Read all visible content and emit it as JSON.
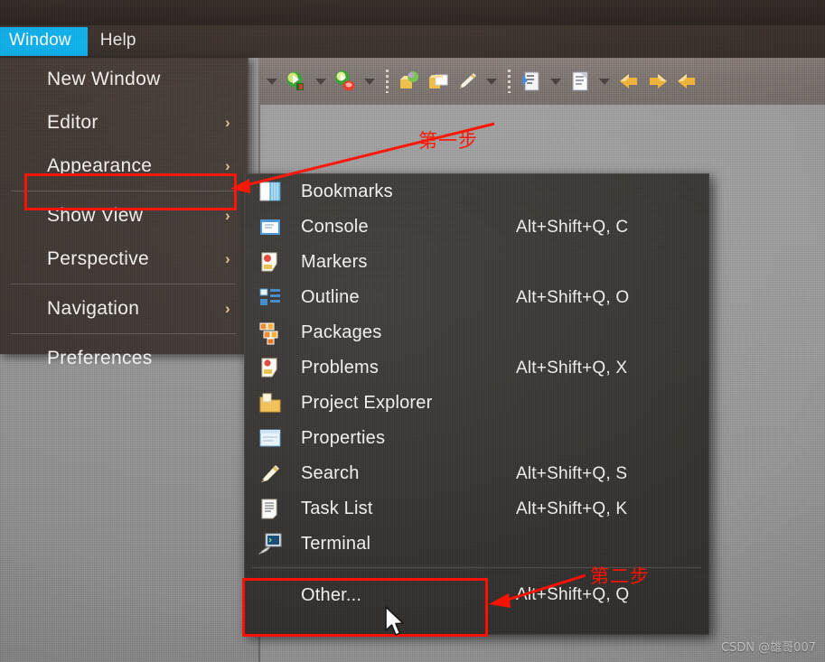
{
  "menubar": {
    "items": [
      {
        "label": "Window",
        "active": true
      },
      {
        "label": "Help",
        "active": false
      }
    ]
  },
  "window_menu": {
    "items": [
      {
        "label": "New Window",
        "arrow": ""
      },
      {
        "label": "Editor",
        "arrow": "›"
      },
      {
        "label": "Appearance",
        "arrow": "›"
      },
      {
        "label": "Show View",
        "arrow": "›"
      },
      {
        "label": "Perspective",
        "arrow": "›"
      },
      {
        "label": "Navigation",
        "arrow": "›"
      },
      {
        "label": "Preferences",
        "arrow": ""
      }
    ]
  },
  "show_view_submenu": {
    "items": [
      {
        "icon": "bookmarks-icon",
        "label": "Bookmarks",
        "shortcut": ""
      },
      {
        "icon": "console-icon",
        "label": "Console",
        "shortcut": "Alt+Shift+Q, C"
      },
      {
        "icon": "markers-icon",
        "label": "Markers",
        "shortcut": ""
      },
      {
        "icon": "outline-icon",
        "label": "Outline",
        "shortcut": "Alt+Shift+Q, O"
      },
      {
        "icon": "packages-icon",
        "label": "Packages",
        "shortcut": ""
      },
      {
        "icon": "problems-icon",
        "label": "Problems",
        "shortcut": "Alt+Shift+Q, X"
      },
      {
        "icon": "project-explorer-icon",
        "label": "Project Explorer",
        "shortcut": ""
      },
      {
        "icon": "properties-icon",
        "label": "Properties",
        "shortcut": ""
      },
      {
        "icon": "search-icon",
        "label": "Search",
        "shortcut": "Alt+Shift+Q, S"
      },
      {
        "icon": "task-list-icon",
        "label": "Task List",
        "shortcut": "Alt+Shift+Q, K"
      },
      {
        "icon": "terminal-icon",
        "label": "Terminal",
        "shortcut": ""
      }
    ],
    "other": {
      "label": "Other...",
      "shortcut": "Alt+Shift+Q, Q"
    }
  },
  "toolbar": {
    "icons": [
      "run-icon",
      "run-dropdown-caret",
      "debug-icon",
      "debug-dropdown-caret",
      "separator-1",
      "external-tools-icon",
      "open-type-icon",
      "new-icon",
      "new-dropdown-caret",
      "separator-2",
      "next-annotation-icon",
      "next-annotation-caret",
      "previous-edit-icon",
      "previous-edit-caret",
      "back-icon",
      "forward-icon",
      "back-arrow-icon"
    ]
  },
  "annotations": {
    "step_one": "第一步",
    "step_two": "第二步",
    "highlight_color": "#FE1100"
  },
  "watermark": {
    "text": "CSDN @雄哥007"
  }
}
